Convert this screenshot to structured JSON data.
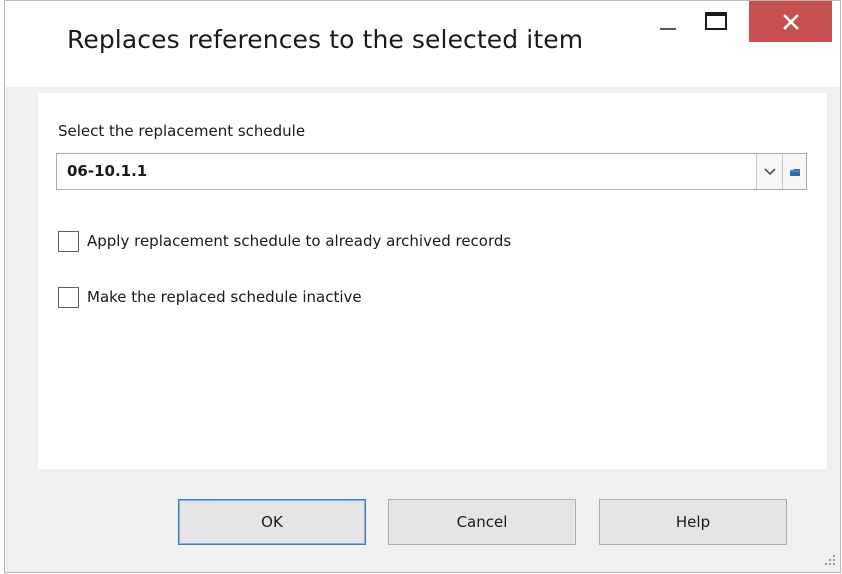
{
  "window": {
    "title": "Replaces references to the selected item"
  },
  "colors": {
    "close_button": "#c75050",
    "ok_border": "#3c7fb1",
    "folder_icon": "#2a6fb6"
  },
  "form": {
    "schedule_label": "Select the replacement schedule",
    "schedule_value": "06-10.1.1",
    "option_apply_archived": "Apply replacement schedule to already archived records",
    "option_make_inactive": "Make the replaced schedule inactive"
  },
  "buttons": {
    "ok": "OK",
    "cancel": "Cancel",
    "help": "Help"
  },
  "icons": {
    "minimize": "minimize-icon",
    "maximize": "maximize-icon",
    "close": "close-icon",
    "dropdown": "chevron-down-icon",
    "open": "folder-icon",
    "resize": "resize-grip-icon"
  }
}
